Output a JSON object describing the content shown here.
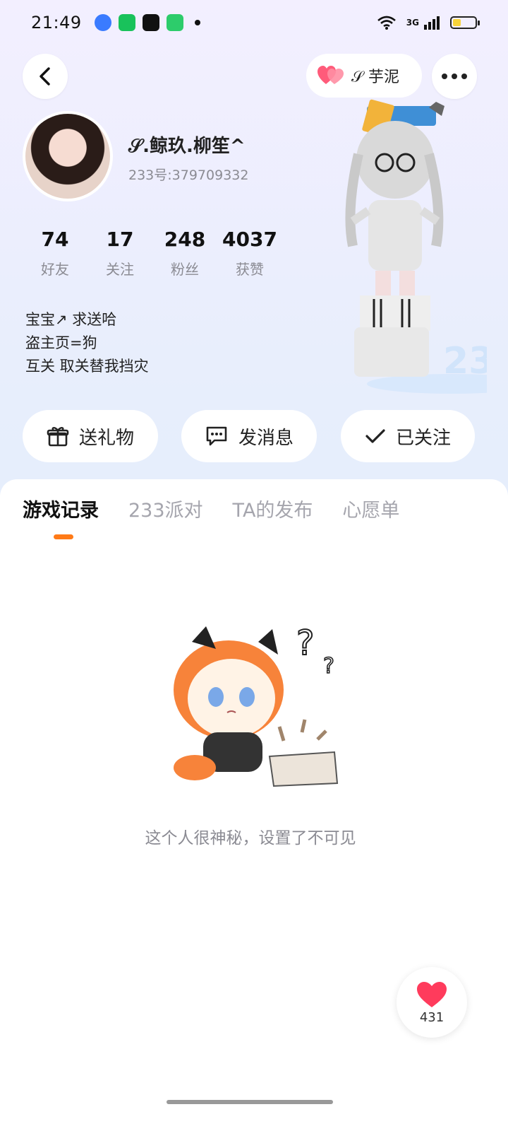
{
  "status_bar": {
    "time": "21:49",
    "network": "3G",
    "icons": [
      "wifi-icon",
      "signal-icon",
      "battery-icon"
    ],
    "battery_level": 0.35
  },
  "header": {
    "partner_name": "𝒮 芋泥"
  },
  "profile": {
    "nickname": "𝒮.鲸玖.柳笙^",
    "user_id": "233号:379709332",
    "stats": [
      {
        "value": "74",
        "label": "好友"
      },
      {
        "value": "17",
        "label": "关注"
      },
      {
        "value": "248",
        "label": "粉丝"
      },
      {
        "value": "4037",
        "label": "获赞"
      }
    ],
    "bio_lines": [
      "宝宝↗ 求送哈",
      "盗主页=狗",
      "互关 取关替我挡灾"
    ]
  },
  "actions": {
    "gift": "送礼物",
    "message": "发消息",
    "follow": "已关注"
  },
  "tabs": [
    "游戏记录",
    "233派对",
    "TA的发布",
    "心愿单"
  ],
  "empty_state": {
    "text": "这个人很神秘，设置了不可见"
  },
  "like_button": {
    "count": "431"
  },
  "colors": {
    "accent": "#ff7a17",
    "heart": "#ff3b5c"
  }
}
